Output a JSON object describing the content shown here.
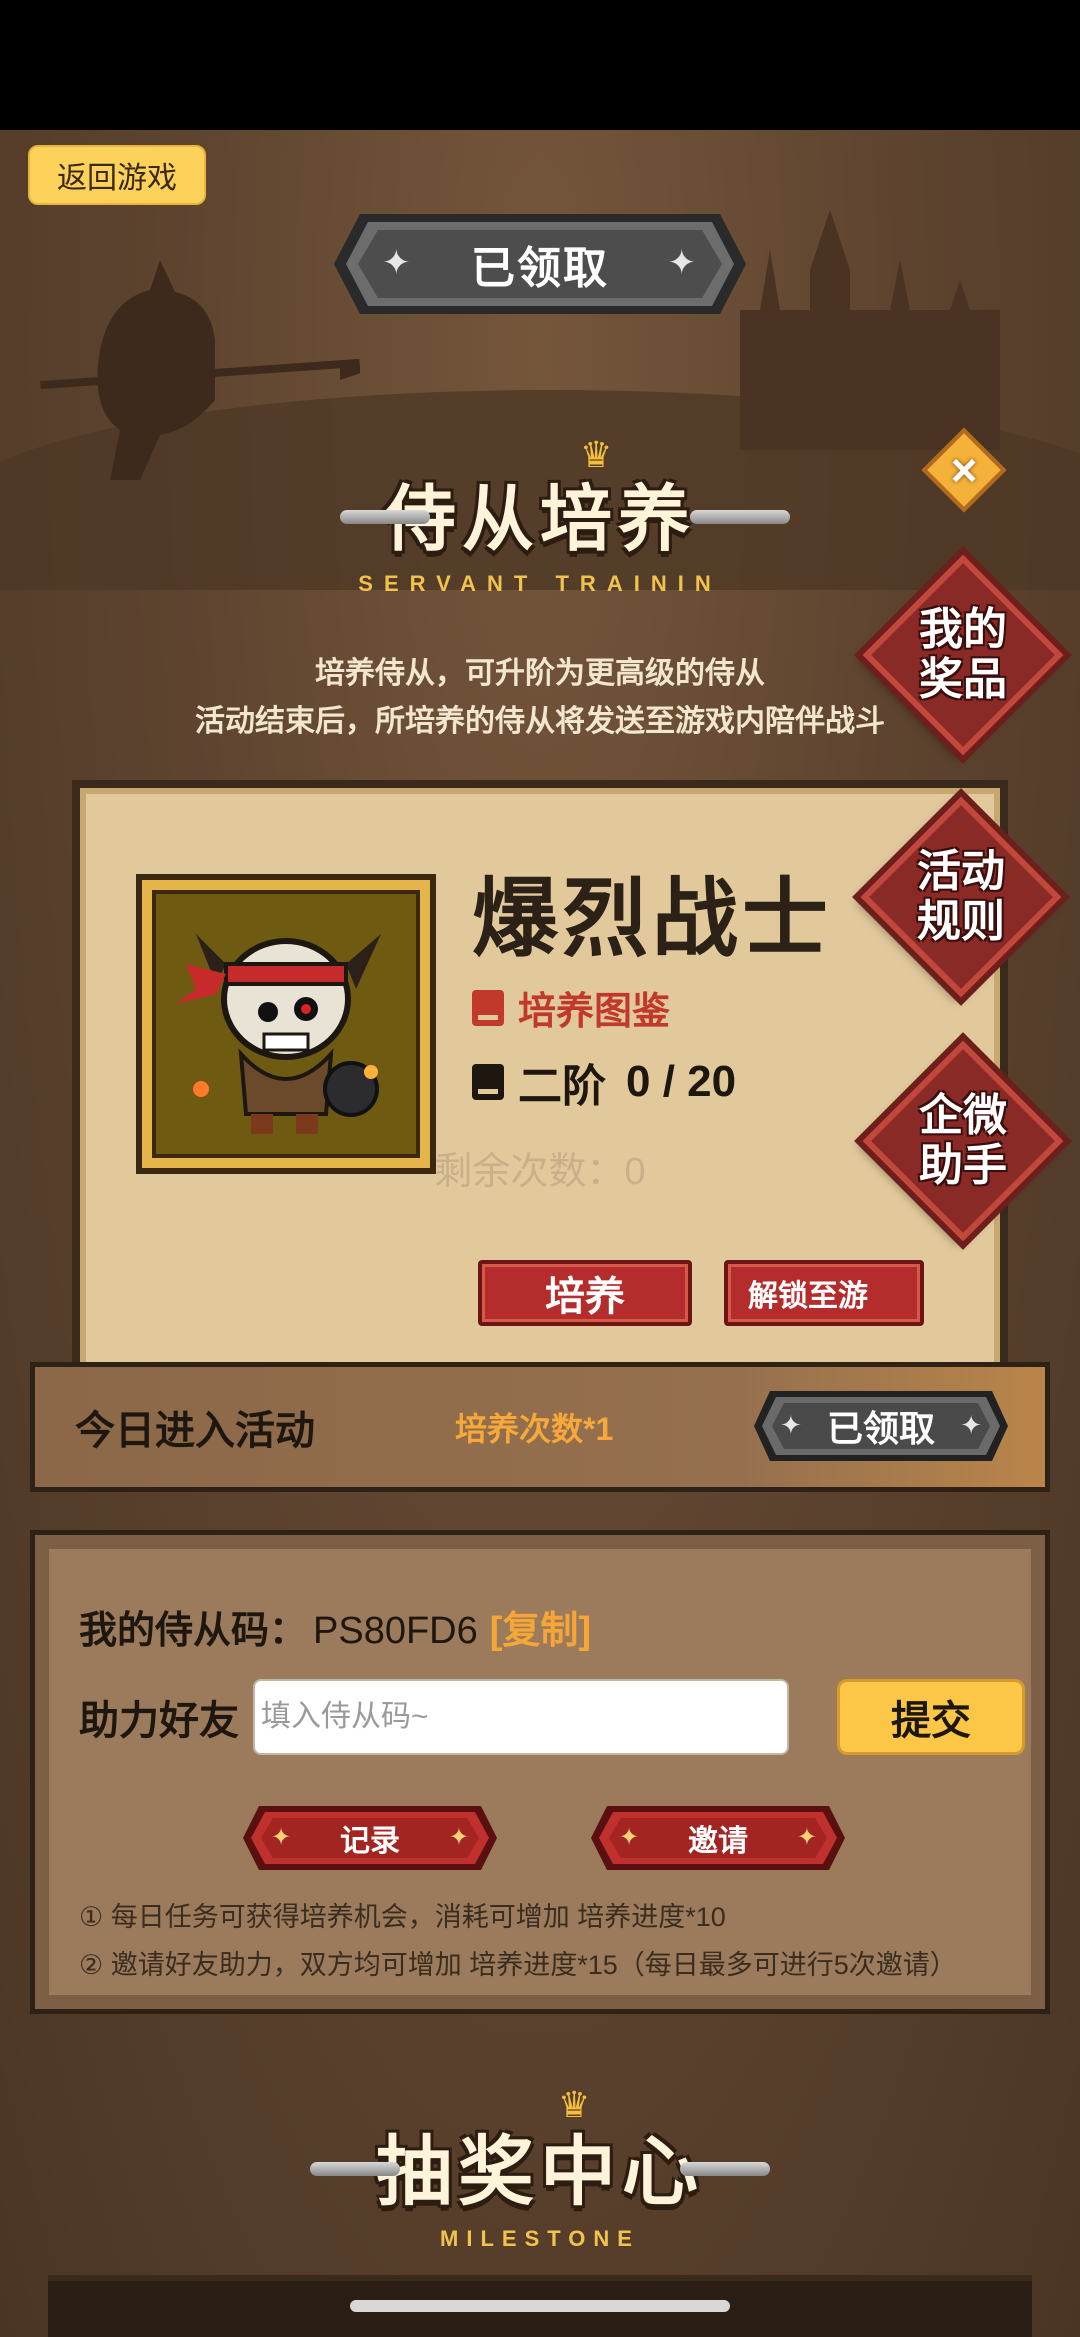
{
  "top_bar": {
    "back_label": "返回游戏",
    "claimed_label": "已领取"
  },
  "title": {
    "main": "侍从培养",
    "sub": "SERVANT TRAININ"
  },
  "description": {
    "line1": "培养侍从，可升阶为更高级的侍从",
    "line2": "活动结束后，所培养的侍从将发送至游戏内陪伴战斗"
  },
  "side_buttons": {
    "prizes": "我的奖品",
    "rules": "活动规则",
    "assistant": "企微助手",
    "close": "×"
  },
  "servant_card": {
    "name": "爆烈战士",
    "codex_label": "培养图鉴",
    "rank_label": "二阶",
    "progress_text": "0 / 20",
    "progress_current": 0,
    "progress_max": 20,
    "train_button": "培养",
    "unlock_button": "解锁至游"
  },
  "remaining": "剩余次数：0",
  "daily_task": {
    "name": "今日进入活动",
    "reward": "培养次数*1",
    "status": "已领取"
  },
  "invite": {
    "code_label": "我的侍从码：",
    "code_value": "PS80FD6",
    "copy_label": "[复制]",
    "help_label": "助力好友",
    "help_placeholder": "填入侍从码~",
    "submit_label": "提交",
    "record_label": "记录",
    "invite_label": "邀请",
    "note1": "① 每日任务可获得培养机会，消耗可增加 培养进度*10",
    "note2": "② 邀请好友助力，双方均可增加 培养进度*15（每日最多可进行5次邀请）"
  },
  "lottery": {
    "main": "抽奖中心",
    "sub": "MILESTONE"
  },
  "colors": {
    "accent_yellow": "#fcd25a",
    "button_red": "#b52c2c",
    "reward_orange": "#f7a83a",
    "card_bg": "#e2c99c"
  },
  "icons": [
    "close-icon",
    "star-icon",
    "book-icon",
    "crown-icon",
    "sword-icon"
  ]
}
